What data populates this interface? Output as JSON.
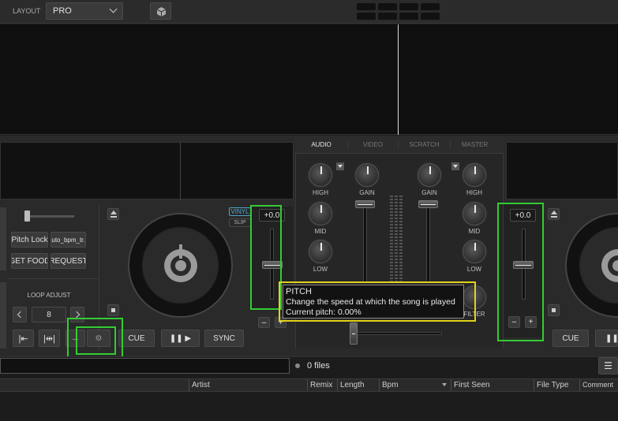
{
  "top": {
    "layout_label": "LAYOUT",
    "layout_value": "PRO"
  },
  "mixer": {
    "tabs": [
      "AUDIO",
      "VIDEO",
      "SCRATCH",
      "MASTER"
    ],
    "left_eq": [
      "HIGH",
      "MID",
      "LOW"
    ],
    "right_eq": [
      "HIGH",
      "MID",
      "LOW"
    ],
    "gain_left": "GAIN",
    "gain_right": "GAIN",
    "filter_label": "FILTER"
  },
  "deck_left": {
    "pitch_lock": "Pitch Lock",
    "auto_bpm": "auto_bpm_tr...",
    "get_food": "GET FOOD",
    "request": "REQUEST",
    "loop_adjust": "LOOP ADJUST",
    "loop_value": "8",
    "vinyl": "VINYL",
    "slip": "SLIP",
    "pitch_value": "+0.0",
    "cue": "CUE",
    "play_pause": "❚❚ ▶",
    "sync": "SYNC",
    "minus": "–",
    "plus": "+"
  },
  "deck_right": {
    "pitch_value": "+0.0",
    "cue": "CUE",
    "play_pause": "❚❚",
    "minus": "–",
    "plus": "+"
  },
  "tooltip": {
    "title": "PITCH",
    "line1": "Change the speed at which the song is played",
    "line2": "Current pitch: 0.00%"
  },
  "browser": {
    "file_count": "0 files",
    "columns": [
      "Artist",
      "Remix",
      "Length",
      "Bpm",
      "First Seen",
      "File Type",
      "Comment"
    ]
  },
  "colors": {
    "highlight_green": "#33cc33",
    "highlight_yellow": "#e0d21c",
    "vinyl_accent": "#4aa3c8"
  }
}
